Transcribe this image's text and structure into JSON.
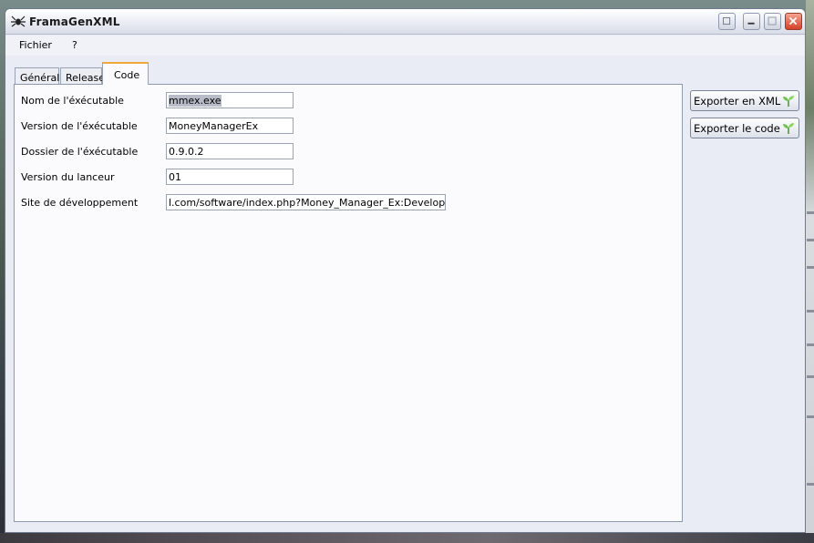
{
  "window": {
    "title": "FramaGenXML",
    "controls": [
      "extra-icon",
      "minimize-icon",
      "maximize-icon",
      "close-icon"
    ]
  },
  "menu": {
    "items": [
      {
        "label": "Fichier"
      },
      {
        "label": "?"
      }
    ]
  },
  "tabs": [
    {
      "label": "Général",
      "active": false
    },
    {
      "label": "Release",
      "active": false
    },
    {
      "label": "Code",
      "active": true
    }
  ],
  "form": {
    "fields": [
      {
        "label": "Nom de l'éxécutable",
        "value": "mmex.exe",
        "selected": true
      },
      {
        "label": "Version de l'éxécutable",
        "value": "MoneyManagerEx"
      },
      {
        "label": "Dossier de l'éxécutable",
        "value": "0.9.0.2"
      },
      {
        "label": "Version du lanceur",
        "value": "01"
      },
      {
        "label": "Site de développement",
        "value": "l.com/software/index.php?Money_Manager_Ex:Development"
      }
    ]
  },
  "actions": {
    "export_xml": "Exporter en XML",
    "export_code": "Exporter le code",
    "icon": "leaf-icon"
  },
  "colors": {
    "active_tab_accent": "#f0a83a",
    "close_button": "#d4422a",
    "selection": "#b8bcc8"
  }
}
